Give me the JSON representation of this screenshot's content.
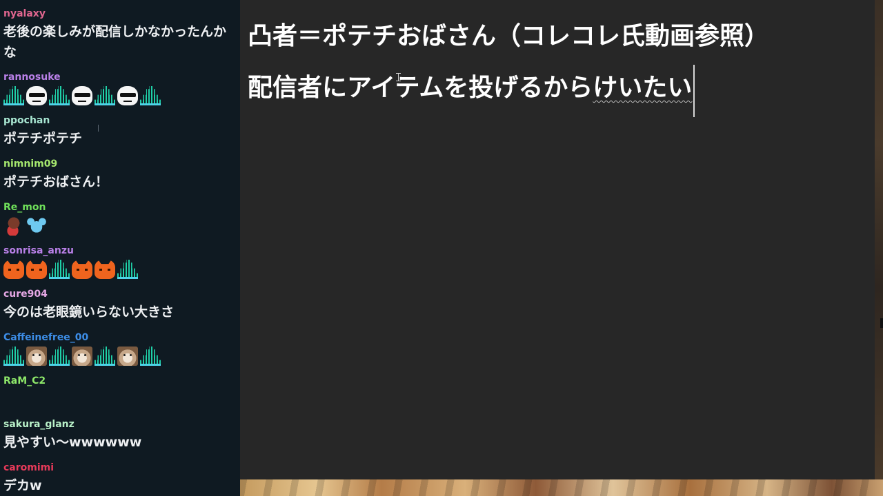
{
  "chat": {
    "messages": [
      {
        "user": "nyalaxy",
        "color": "#e0668f",
        "text": "老後の楽しみが配信しかなかったんかな"
      },
      {
        "user": "rannosuke",
        "color": "#b980e8",
        "emotes": [
          "equalizer-emote",
          "sunglasses-emote",
          "equalizer-emote",
          "sunglasses-emote",
          "equalizer-emote",
          "sunglasses-emote",
          "equalizer-emote"
        ]
      },
      {
        "user": "ppochan",
        "color": "#a8e6d2",
        "text": "ポテチポテチ"
      },
      {
        "user": "nimnim09",
        "color": "#a6e86e",
        "text": "ポテチおばさん！"
      },
      {
        "user": "Re_mon",
        "color": "#6fe05a",
        "emotes": [
          "character-emote",
          "mouse-emote"
        ]
      },
      {
        "user": "sonrisa_anzu",
        "color": "#b980e8",
        "emotes": [
          "orange-cat-emote",
          "orange-cat-emote",
          "equalizer-emote",
          "orange-cat-emote",
          "orange-cat-emote",
          "equalizer-emote"
        ]
      },
      {
        "user": "cure904",
        "color": "#e6a8e6",
        "text": "今のは老眼鏡いらない大きさ"
      },
      {
        "user": "Caffeinefree_00",
        "color": "#3d8ee8",
        "emotes": [
          "equalizer-emote",
          "cat-photo-emote",
          "equalizer-emote",
          "cat-photo-emote",
          "equalizer-emote",
          "cat-photo-emote",
          "equalizer-emote"
        ]
      },
      {
        "user": "RaM_C2",
        "color": "#8ee86a",
        "text": ""
      },
      {
        "user": "sakura_glanz",
        "color": "#b8f0c8",
        "text": "見やすい〜wwwwww"
      },
      {
        "user": "caromimi",
        "color": "#e83a5a",
        "text": "デカw"
      }
    ]
  },
  "editor": {
    "line1": "凸者＝ポテチおばさん（コレコレ氏動画参照）",
    "line2_committed": "配信者にアイテムを投げるから",
    "line2_composing": "けいたい"
  },
  "colors": {
    "chat_bg": "#0f1a22",
    "editor_bg": "#272727",
    "editor_text": "#ffffff",
    "chat_text": "#eef0f2"
  }
}
